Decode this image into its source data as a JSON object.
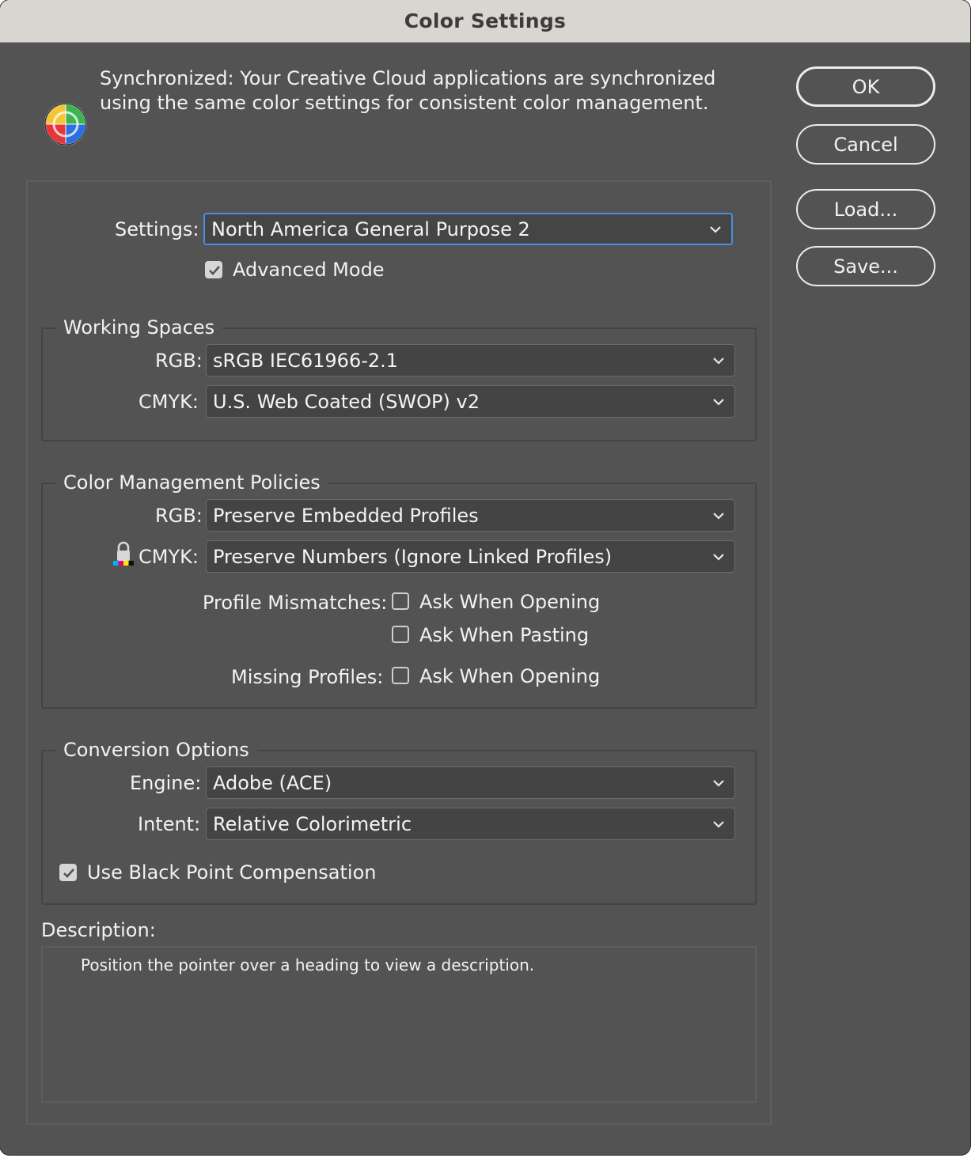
{
  "window": {
    "title": "Color Settings"
  },
  "sync": {
    "icon": "color-wheel-icon",
    "message": "Synchronized: Your Creative Cloud applications are synchronized using the same color settings for consistent color management."
  },
  "buttons": {
    "ok": "OK",
    "cancel": "Cancel",
    "load": "Load...",
    "save": "Save..."
  },
  "settings": {
    "label": "Settings:",
    "value": "North America General Purpose 2",
    "advanced_mode_label": "Advanced Mode",
    "advanced_mode_checked": true
  },
  "working_spaces": {
    "title": "Working Spaces",
    "rgb_label": "RGB:",
    "rgb_value": "sRGB IEC61966-2.1",
    "cmyk_label": "CMYK:",
    "cmyk_value": "U.S. Web Coated (SWOP) v2"
  },
  "policies": {
    "title": "Color Management Policies",
    "rgb_label": "RGB:",
    "rgb_value": "Preserve Embedded Profiles",
    "cmyk_label": "CMYK:",
    "cmyk_value": "Preserve Numbers (Ignore Linked Profiles)",
    "cmyk_icon": "lock-icon",
    "profile_mismatches_label": "Profile Mismatches:",
    "ask_when_opening": "Ask When Opening",
    "ask_when_pasting": "Ask When Pasting",
    "missing_profiles_label": "Missing Profiles:",
    "missing_ask_when_opening": "Ask When Opening"
  },
  "conversion": {
    "title": "Conversion Options",
    "engine_label": "Engine:",
    "engine_value": "Adobe (ACE)",
    "intent_label": "Intent:",
    "intent_value": "Relative Colorimetric",
    "black_point_label": "Use Black Point Compensation",
    "black_point_checked": true
  },
  "description": {
    "label": "Description:",
    "text": "Position the pointer over a heading to view a description."
  },
  "colors": {
    "window_bg": "#535353",
    "titlebar_bg": "#d9d5d0",
    "focus_ring": "#4a8de6",
    "dropdown_bg": "#444444"
  }
}
